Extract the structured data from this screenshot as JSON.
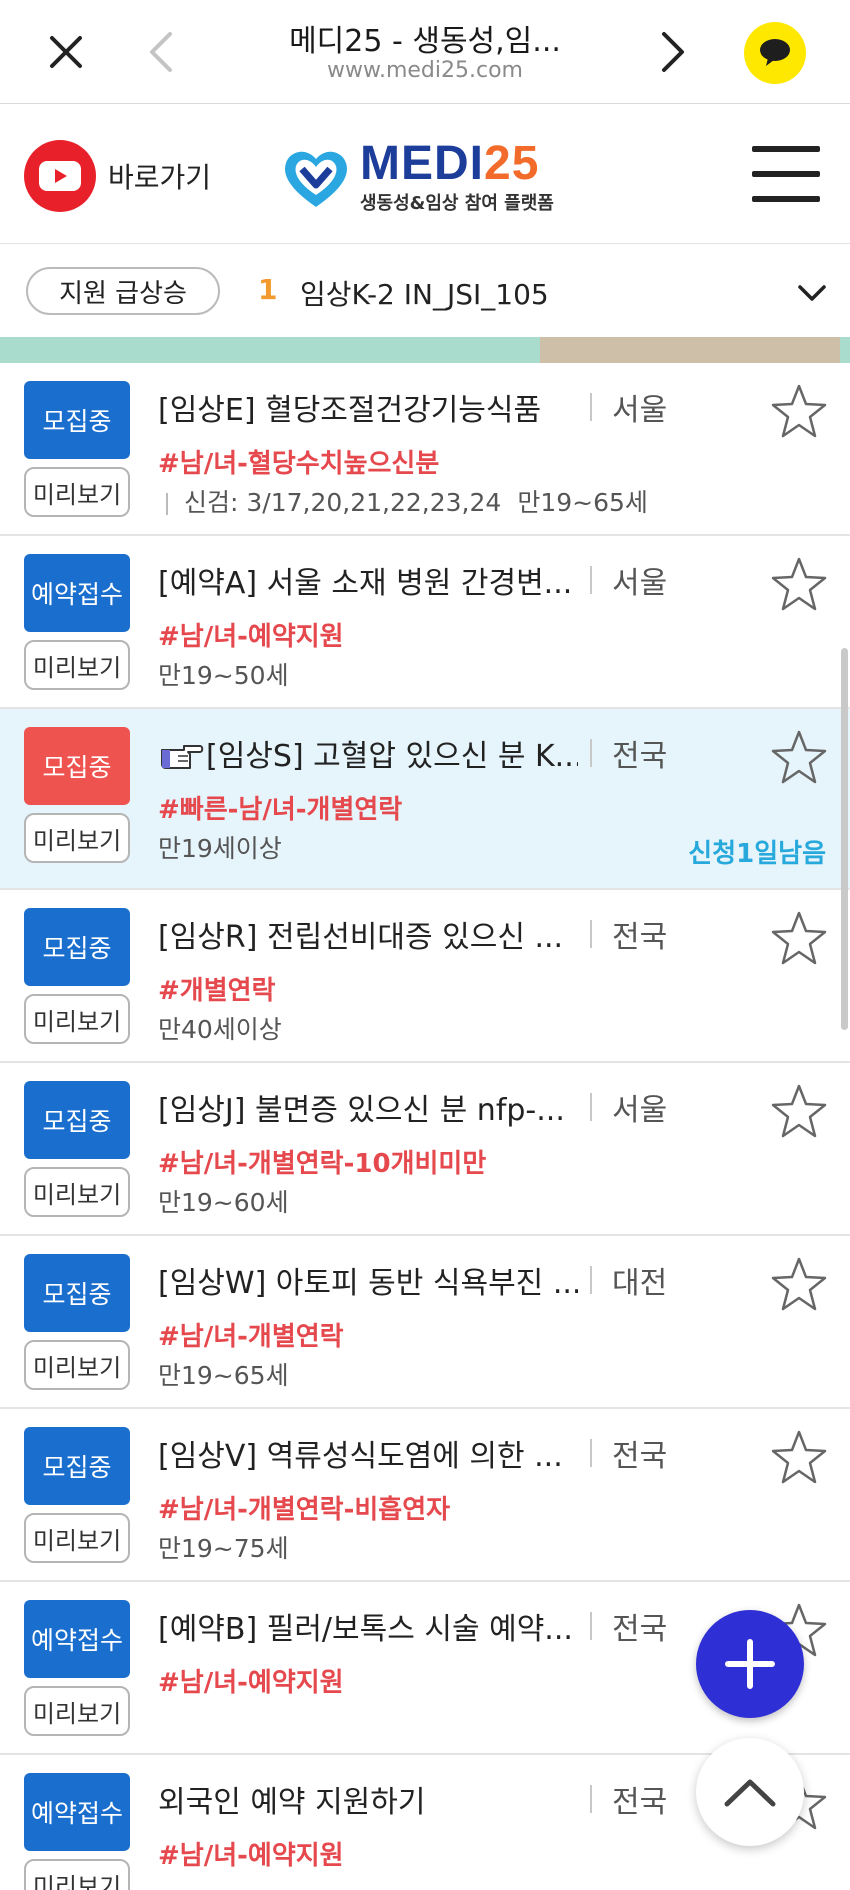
{
  "browser": {
    "title": "메디25 - 생동성,임...",
    "url": "www.medi25.com"
  },
  "header": {
    "youtube_label": "바로가기",
    "logo_main_1": "MEDI",
    "logo_main_2": "25",
    "logo_sub": "생동성&임상 참여 플랫폼"
  },
  "ticker": {
    "pill": "지원 급상승",
    "rank": "1",
    "text": "임상K-2 IN_JSI_105"
  },
  "list": [
    {
      "status": "모집중",
      "status_color": "#1a6fce",
      "preview": "미리보기",
      "title": "[임상E] 혈당조절건강기능식품",
      "region": "서울",
      "tag": "#남/녀-혈당수치높으신분",
      "checkup": "신검: 3/17,20,21,22,23,24",
      "age": "만19~65세"
    },
    {
      "status": "예약접수",
      "status_color": "#1a6fce",
      "preview": "미리보기",
      "title": "[예약A] 서울 소재 병원 간경변...",
      "region": "서울",
      "tag": "#남/녀-예약지원",
      "age": "만19~50세"
    },
    {
      "status": "모집중",
      "status_color": "#ef5350",
      "preview": "미리보기",
      "title": "[임상S] 고혈압 있으신 분 K...",
      "region": "전국",
      "tag": "#빠른-남/녀-개별연락",
      "age": "만19세이상",
      "deadline": "신청1일남음"
    },
    {
      "status": "모집중",
      "status_color": "#1a6fce",
      "preview": "미리보기",
      "title": "[임상R] 전립선비대증 있으신 ...",
      "region": "전국",
      "tag": "#개별연락",
      "age": "만40세이상"
    },
    {
      "status": "모집중",
      "status_color": "#1a6fce",
      "preview": "미리보기",
      "title": "[임상J] 불면증 있으신 분 nfp-...",
      "region": "서울",
      "tag": "#남/녀-개별연락-10개비미만",
      "age": "만19~60세"
    },
    {
      "status": "모집중",
      "status_color": "#1a6fce",
      "preview": "미리보기",
      "title": "[임상W] 아토피 동반 식욕부진 ...",
      "region": "대전",
      "tag": "#남/녀-개별연락",
      "age": "만19~65세"
    },
    {
      "status": "모집중",
      "status_color": "#1a6fce",
      "preview": "미리보기",
      "title": "[임상V] 역류성식도염에 의한 ...",
      "region": "전국",
      "tag": "#남/녀-개별연락-비흡연자",
      "age": "만19~75세"
    },
    {
      "status": "예약접수",
      "status_color": "#1a6fce",
      "preview": "미리보기",
      "title": "[예약B] 필러/보톡스 시술 예약...",
      "region": "전국",
      "tag": "#남/녀-예약지원",
      "age": ""
    },
    {
      "status": "예약접수",
      "status_color": "#1a6fce",
      "preview": "미리보기",
      "title": "외국인 예약 지원하기",
      "region": "전국",
      "tag": "#남/녀-예약지원",
      "age": ""
    }
  ],
  "colors": {
    "brand_blue": "#1c3d9a",
    "brand_orange": "#f26b2a",
    "status_blue": "#1a6fce",
    "status_red": "#ef5350",
    "tag_red": "#e5484d",
    "deadline_blue": "#28a9dc",
    "fab": "#2f2fd6"
  },
  "icons": {
    "close": "close-icon",
    "back": "chevron-left-icon",
    "forward": "chevron-right-icon",
    "kakao": "kakao-chat-icon",
    "youtube": "youtube-play-icon",
    "menu": "hamburger-icon",
    "expand": "chevron-down-icon",
    "favorite": "star-outline-icon",
    "pointer": "pointing-hand-icon",
    "add": "plus-icon",
    "scroll_top": "chevron-up-icon"
  }
}
